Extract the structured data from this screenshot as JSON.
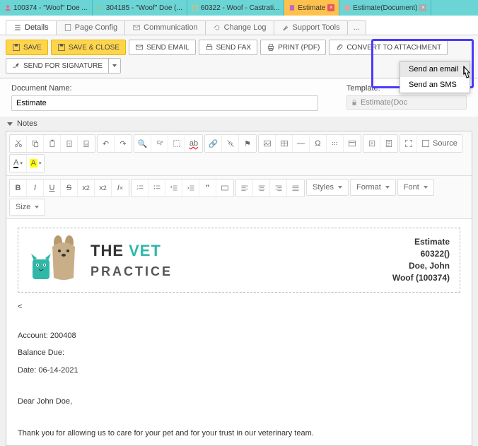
{
  "tabs": [
    {
      "label": "100374 - \"Woof\" Doe ...",
      "color": "#f06292"
    },
    {
      "label": "304185 - \"Woof\" Doe (...",
      "color": "#9ccc65"
    },
    {
      "label": "60322 - Woof - Castrati...",
      "color": "#ffb74d"
    },
    {
      "label": "Estimate",
      "color": "#ba68c8",
      "active": true
    },
    {
      "label": "Estimate(Document)",
      "color": "#ef9a9a"
    }
  ],
  "subtabs": {
    "details": "Details",
    "page_config": "Page Config",
    "communication": "Communication",
    "change_log": "Change Log",
    "support_tools": "Support Tools",
    "more": "..."
  },
  "toolbar": {
    "save": "SAVE",
    "save_close": "SAVE & CLOSE",
    "send_email": "SEND EMAIL",
    "send_fax": "SEND FAX",
    "print_pdf": "PRINT (PDF)",
    "convert_attachment": "CONVERT TO ATTACHMENT",
    "send_signature": "SEND FOR SIGNATURE"
  },
  "form": {
    "doc_name_label": "Document Name:",
    "doc_name_value": "Estimate",
    "template_label": "Template:",
    "template_value": "Estimate(Doc"
  },
  "notes_label": "Notes",
  "editor": {
    "source": "Source",
    "styles": "Styles",
    "format": "Format",
    "font": "Font",
    "size": "Size"
  },
  "dropdown": {
    "email": "Send an email",
    "sms": "Send an SMS"
  },
  "document": {
    "logo_line1_a": "THE",
    "logo_line1_b": "VET",
    "logo_line2": "PRACTICE",
    "header_lines": [
      "Estimate",
      "60322()",
      "Doe, John",
      "Woof (100374)"
    ],
    "lt": "<",
    "account_label": "Account:",
    "account_value": "200408",
    "balance_label": "Balance Due:",
    "date_label": "Date:",
    "date_value": "06-14-2021",
    "greeting": "Dear John Doe,",
    "body": "Thank you for allowing us to care for your pet and for your trust in our veterinary team."
  }
}
